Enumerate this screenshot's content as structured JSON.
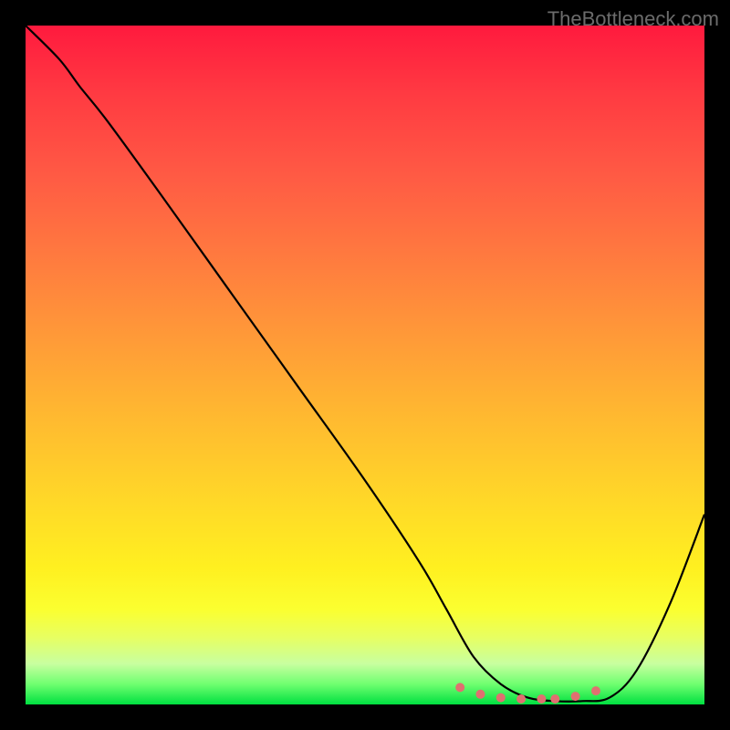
{
  "watermark": "TheBottleneck.com",
  "chart_data": {
    "type": "line",
    "title": "",
    "xlabel": "",
    "ylabel": "",
    "xlim": [
      0,
      100
    ],
    "ylim": [
      0,
      100
    ],
    "series": [
      {
        "name": "curve",
        "x": [
          0,
          5,
          8,
          12,
          20,
          30,
          40,
          50,
          58,
          62,
          66,
          70,
          74,
          78,
          82,
          86,
          90,
          95,
          100
        ],
        "values": [
          100,
          95,
          91,
          86,
          75,
          61,
          47,
          33,
          21,
          14,
          7,
          3,
          1,
          0.5,
          0.5,
          1,
          5,
          15,
          28
        ]
      }
    ],
    "dots": {
      "name": "bottom-dots",
      "color": "#e07070",
      "x": [
        64,
        67,
        70,
        73,
        76,
        78,
        81,
        84
      ],
      "y": [
        2.5,
        1.5,
        1,
        0.8,
        0.8,
        0.8,
        1.2,
        2
      ]
    },
    "gradient": {
      "top": "#ff1a3e",
      "mid_upper": "#ff9a38",
      "mid_lower": "#fff020",
      "bottom": "#00e040"
    }
  }
}
